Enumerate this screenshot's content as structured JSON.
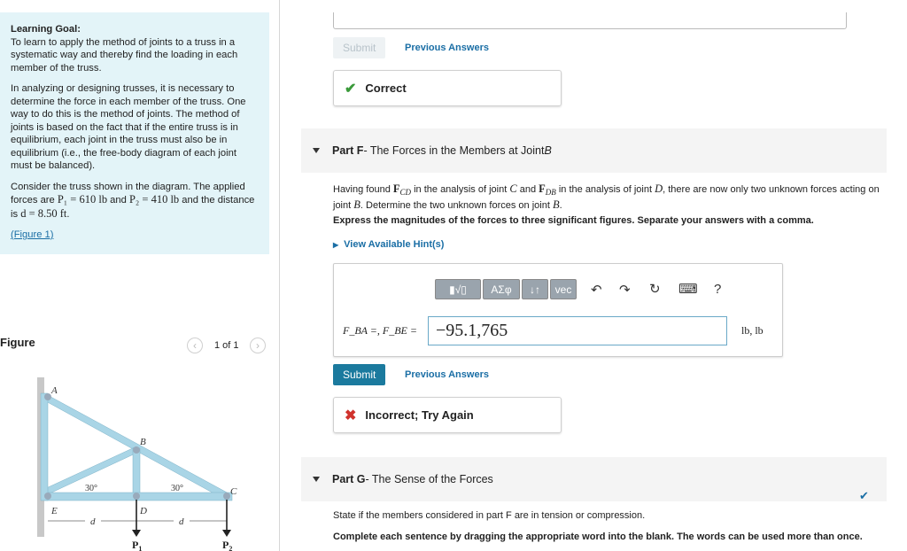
{
  "goal": {
    "heading": "Learning Goal:",
    "p1": "To learn to apply the method of joints to a truss in a systematic way and thereby find the loading in each member of the truss.",
    "p2": "In analyzing or designing trusses, it is necessary to determine the force in each member of the truss. One way to do this is the method of joints. The method of joints is based on the fact that if the entire truss is in equilibrium, each joint in the truss must also be in equilibrium (i.e., the free-body diagram of each joint must be balanced).",
    "p3a": "Consider the truss shown in the diagram. The applied forces are ",
    "p1_sym": "P₁ = 610 lb",
    "and": " and ",
    "p2_sym": "P₂ = 410 lb",
    "p3b": " and the distance is ",
    "d_sym": "d = 8.50 ft",
    "p3c": ".",
    "figure_link": "(Figure 1)"
  },
  "figure": {
    "heading": "Figure",
    "pager": "1 of 1",
    "labels": {
      "A": "A",
      "B": "B",
      "C": "C",
      "D": "D",
      "E": "E",
      "ang1": "30°",
      "ang2": "30°",
      "d1": "d",
      "d2": "d",
      "P1": "P",
      "P1sub": "1",
      "P2": "P",
      "P2sub": "2"
    }
  },
  "top": {
    "submit": "Submit",
    "previous": "Previous Answers",
    "feedback": "Correct"
  },
  "partF": {
    "label": "Part F",
    "title": " - The Forces in the Members at Joint ",
    "joint": "B",
    "q1": "Having found ",
    "fcd": "F",
    "fcd_sub": "CD",
    "q2": " in the analysis of joint ",
    "jc": "C",
    "q3": " and ",
    "fdb": "F",
    "fdb_sub": "DB",
    "q4": " in the analysis of joint ",
    "jd": "D",
    "q5": ", there are now only two unknown forces acting on joint ",
    "jb": "B",
    "q6": ". Determine the two unknown forces on joint ",
    "jb2": "B",
    "q7": ".",
    "instruction": "Express the magnitudes of the forces to three significant figures. Separate your answers with a comma.",
    "hints": "View Available Hint(s)",
    "toolbar": {
      "templates": "▮√▯",
      "greek": "ΑΣφ",
      "arrows": "↓↑",
      "vec": "vec",
      "undo": "↶",
      "redo": "↷",
      "reset": "↻",
      "keyboard": "⌨",
      "help": "?"
    },
    "input_label": "F_BA =, F_BE =",
    "input_value": "−95.1,765",
    "units": "lb, lb",
    "submit": "Submit",
    "previous": "Previous Answers",
    "feedback": "Incorrect; Try Again"
  },
  "partG": {
    "label": "Part G",
    "title": " - The Sense of the Forces",
    "q": "State if the members considered in part F are in tension or compression.",
    "instruction": "Complete each sentence by dragging the appropriate word into the blank. The words can be used more than once."
  },
  "colors": {
    "goal_bg": "#e3f4f8",
    "submit_bg": "#1b7a9e",
    "correct": "#3a9a3a",
    "incorrect": "#d0322c",
    "link": "#1a6ea5",
    "truss": "#a9d5e6"
  }
}
